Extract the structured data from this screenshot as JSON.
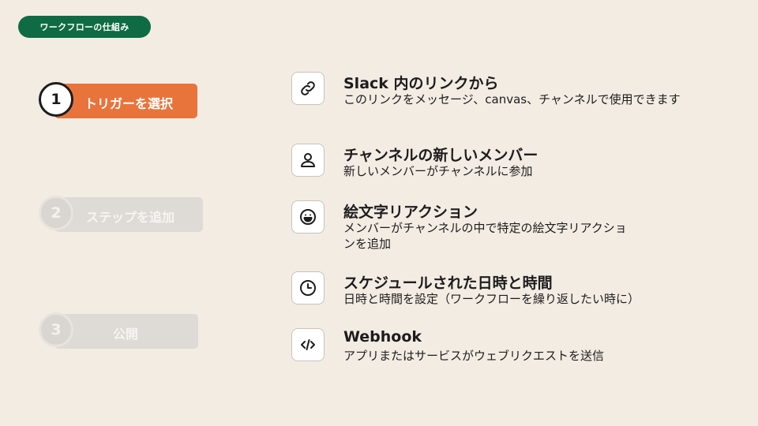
{
  "header": {
    "tag_label": "ワークフローの仕組み"
  },
  "steps": [
    {
      "number": "1",
      "label": "トリガーを選択",
      "state": "active"
    },
    {
      "number": "2",
      "label": "ステップを追加",
      "state": "inactive"
    },
    {
      "number": "3",
      "label": "公開",
      "state": "inactive"
    }
  ],
  "options": [
    {
      "icon": "link-icon",
      "title": "Slack 内のリンクから",
      "description": "このリンクをメッセージ、canvas、チャンネルで使用できます"
    },
    {
      "icon": "user-icon",
      "title": "チャンネルの新しいメンバー",
      "description": "新しいメンバーがチャンネルに参加"
    },
    {
      "icon": "emoji-icon",
      "title": "絵文字リアクション",
      "description": "メンバーがチャンネルの中で特定の絵文字リアクションを追加"
    },
    {
      "icon": "clock-icon",
      "title": "スケジュールされた日時と時間",
      "description": "日時と時間を設定（ワークフローを繰り返したい時に）"
    },
    {
      "icon": "code-icon",
      "title": "Webhook",
      "description": "アプリまたはサービスがウェブリクエストを送信"
    }
  ],
  "colors": {
    "background": "#f3ece3",
    "tag_green": "#0f6b43",
    "active_orange": "#e8743b",
    "inactive_gray": "#dedad5"
  }
}
